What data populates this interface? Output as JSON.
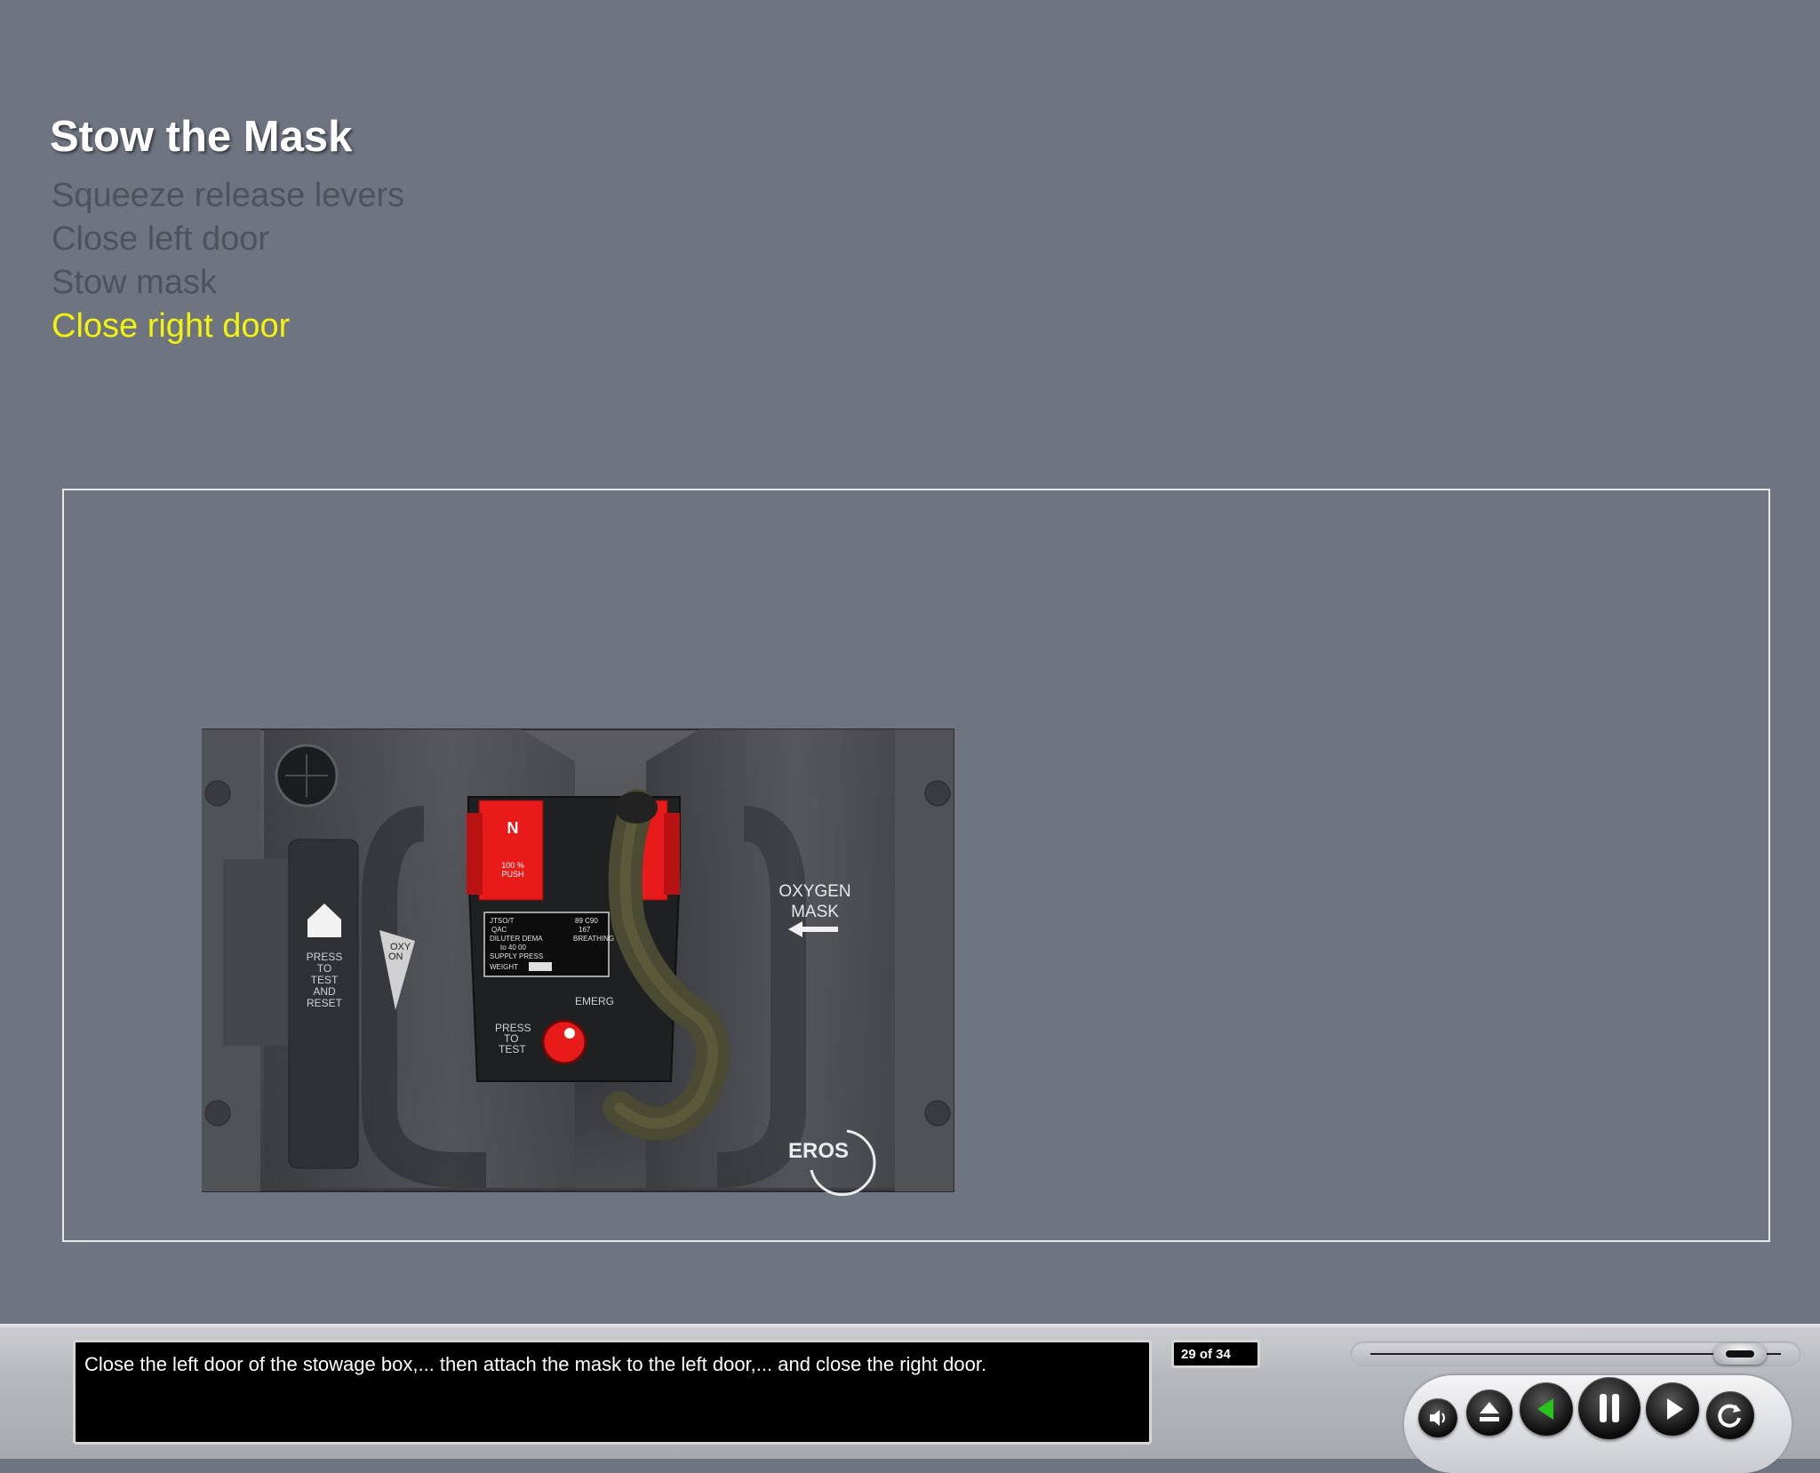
{
  "lesson": {
    "title": "Stow the Mask",
    "steps": [
      {
        "label": "Squeeze release levers",
        "state": "done"
      },
      {
        "label": "Close left door",
        "state": "done"
      },
      {
        "label": "Stow mask",
        "state": "done"
      },
      {
        "label": "Close right door",
        "state": "active"
      }
    ]
  },
  "illustration": {
    "flag_letter": "N",
    "flag_text": "100 %\nPUSH",
    "left_arrow_label": "PRESS\nTO\nTEST\nAND\nRESET",
    "oxy_label": "OXY\nON",
    "panel_label_line1": "OXYGEN",
    "panel_label_line2": "MASK",
    "emerg_label": "EMERG",
    "press_to_test": "PRESS\nTO\nTEST",
    "placard_l1": "JTSO/T",
    "placard_l2": "QAC",
    "placard_l3": "DILUTER DEMA",
    "placard_l4": "to 40 00",
    "placard_l5": "SUPPLY PRESS",
    "placard_l6": "WEIGHT",
    "placard_r1": "89 C90",
    "placard_r2": "167",
    "placard_r3": "BREATHING",
    "brand": "EROS",
    "colors": {
      "flag_red": "#e81a1a",
      "hose": "#4b4a32",
      "panel": "#4a4c50"
    }
  },
  "player": {
    "caption": "Close the left door of the stowage box,... then attach the mask to the left door,... and close the right door.",
    "counter": "29 of 34",
    "progress_fraction": 0.915,
    "buttons": [
      "volume-icon",
      "eject-icon",
      "back-icon",
      "pause-icon",
      "play-icon",
      "replay-icon"
    ],
    "accent": "#28c41c"
  }
}
